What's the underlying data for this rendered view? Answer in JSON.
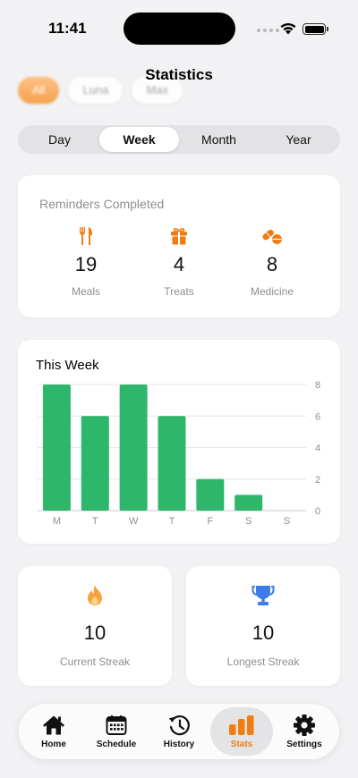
{
  "status_bar": {
    "time": "11:41"
  },
  "header": {
    "title": "Statistics"
  },
  "pets": [
    {
      "label": "All",
      "active": true
    },
    {
      "label": "Luna",
      "active": false
    },
    {
      "label": "Max",
      "active": false
    }
  ],
  "periods": [
    {
      "label": "Day",
      "active": false
    },
    {
      "label": "Week",
      "active": true
    },
    {
      "label": "Month",
      "active": false
    },
    {
      "label": "Year",
      "active": false
    }
  ],
  "reminders": {
    "title": "Reminders Completed",
    "stats": [
      {
        "icon": "fork-knife-icon",
        "value": "19",
        "label": "Meals"
      },
      {
        "icon": "gift-icon",
        "value": "4",
        "label": "Treats"
      },
      {
        "icon": "pills-icon",
        "value": "8",
        "label": "Medicine"
      }
    ]
  },
  "chart_data": {
    "type": "bar",
    "title": "This Week",
    "categories": [
      "M",
      "T",
      "W",
      "T",
      "F",
      "S",
      "S"
    ],
    "values": [
      8,
      6,
      8,
      6,
      2,
      1,
      0
    ],
    "ylim": [
      0,
      8
    ],
    "yticks": [
      0,
      2,
      4,
      6,
      8
    ],
    "y_axis_side": "right",
    "grid": true,
    "bar_color": "#2eb66b"
  },
  "streaks": [
    {
      "icon": "flame-icon",
      "value": "10",
      "label": "Current Streak"
    },
    {
      "icon": "trophy-icon",
      "value": "10",
      "label": "Longest Streak"
    }
  ],
  "tabs": [
    {
      "icon": "house-icon",
      "label": "Home",
      "active": false
    },
    {
      "icon": "calendar-icon",
      "label": "Schedule",
      "active": false
    },
    {
      "icon": "history-clock-icon",
      "label": "History",
      "active": false
    },
    {
      "icon": "bar-chart-icon",
      "label": "Stats",
      "active": true
    },
    {
      "icon": "gear-icon",
      "label": "Settings",
      "active": false
    }
  ],
  "colors": {
    "accent": "#f07d12",
    "bar": "#2eb66b",
    "trophy": "#3b7bea",
    "flame": "#f7a23a"
  }
}
